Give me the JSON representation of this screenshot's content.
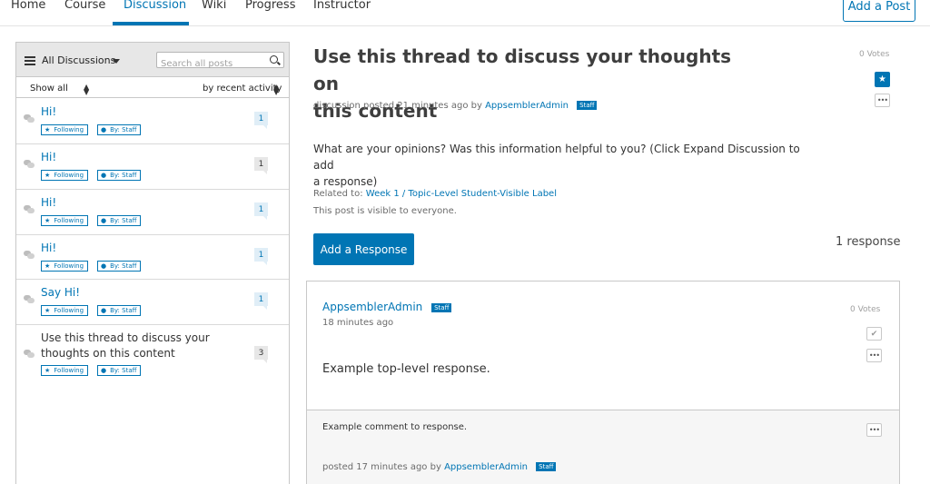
{
  "nav": {
    "tabs": [
      {
        "label": "Home"
      },
      {
        "label": "Course"
      },
      {
        "label": "Discussion",
        "active": true
      },
      {
        "label": "Wiki"
      },
      {
        "label": "Progress"
      },
      {
        "label": "Instructor"
      }
    ],
    "add_post_label": "Add a Post"
  },
  "sidebar": {
    "filter_label": "All Discussions",
    "search_placeholder": "Search all posts",
    "show_label": "Show all",
    "sort_label": "by recent activity",
    "following_label": "Following",
    "by_label": "By: Staff",
    "threads": [
      {
        "title": "Hi!",
        "count": "1",
        "unread": true
      },
      {
        "title": "Hi!",
        "count": "1",
        "unread": false
      },
      {
        "title": "Hi!",
        "count": "1",
        "unread": true
      },
      {
        "title": "Hi!",
        "count": "1",
        "unread": true
      },
      {
        "title": "Say Hi!",
        "count": "1",
        "unread": true
      },
      {
        "title_line1": "Use this thread to discuss your",
        "title_line2": "thoughts on this content",
        "count": "3",
        "unread": false
      }
    ]
  },
  "post": {
    "title_line1": "Use this thread to discuss your thoughts on",
    "title_line2": "this content",
    "votes": "0 Votes",
    "meta_prefix": "discussion posted 21 minutes ago by",
    "author": "AppsemblerAdmin",
    "staff_label": "Staff",
    "body_line1": "What are your opinions? Was this information helpful to you? (Click Expand Discussion to add",
    "body_line2": "a response)",
    "related_prefix": "Related to:",
    "related_link": "Week 1 / Topic-Level Student-Visible Label",
    "visibility": "This post is visible to everyone.",
    "add_response_label": "Add a Response",
    "response_count": "1 response"
  },
  "response": {
    "author": "AppsemblerAdmin",
    "staff_label": "Staff",
    "time": "18 minutes ago",
    "votes": "0 Votes",
    "text": "Example top-level response.",
    "comment": {
      "text": "Example comment to response.",
      "meta_prefix": "posted 17 minutes ago by",
      "author": "AppsemblerAdmin",
      "staff_label": "Staff"
    }
  },
  "icons": {
    "menu": "hamburger-icon",
    "search": "search-icon",
    "star": "star-icon",
    "person": "person-icon",
    "bubble": "speech-bubble-icon",
    "more": "ellipsis-icon",
    "check": "check-icon"
  },
  "colors": {
    "accent": "#0075b4"
  }
}
